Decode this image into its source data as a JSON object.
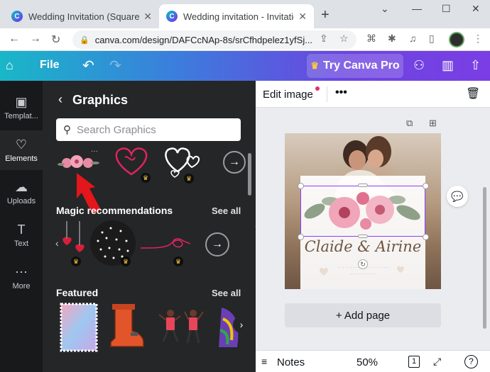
{
  "browser": {
    "tabs": [
      {
        "title": "Wedding Invitation (Square)",
        "active": false
      },
      {
        "title": "Wedding invitation - Invitation (",
        "active": true
      }
    ],
    "url": "canva.com/design/DAFCcNAp-8s/srCfhdpelez1yfSj..."
  },
  "header": {
    "file_label": "File",
    "pro_label": "Try Canva Pro"
  },
  "rail": {
    "items": [
      {
        "label": "Templat...",
        "icon": "layout-icon"
      },
      {
        "label": "Elements",
        "icon": "shapes-icon"
      },
      {
        "label": "Uploads",
        "icon": "cloud-upload-icon"
      },
      {
        "label": "Text",
        "icon": "text-icon"
      },
      {
        "label": "More",
        "icon": "dots-icon"
      }
    ]
  },
  "panel": {
    "title": "Graphics",
    "search_placeholder": "Search Graphics",
    "sections": [
      {
        "title": "Magic recommendations",
        "see_all": "See all"
      },
      {
        "title": "Featured",
        "see_all": "See all"
      }
    ]
  },
  "editor": {
    "toolbar_label": "Edit image",
    "names_text": "Claide & Airine",
    "add_page_label": "+ Add page",
    "footer": {
      "notes_label": "Notes",
      "zoom": "50%",
      "page_count": "1"
    }
  },
  "colors": {
    "accent_purple": "#8b3dff",
    "crown": "#ffc83d",
    "panel_bg": "#252627",
    "rail_bg": "#18191b"
  }
}
